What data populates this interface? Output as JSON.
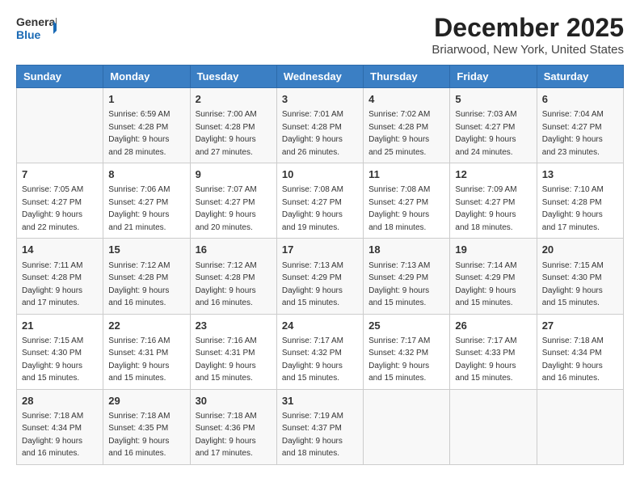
{
  "logo": {
    "line1": "General",
    "line2": "Blue"
  },
  "title": "December 2025",
  "subtitle": "Briarwood, New York, United States",
  "header_color": "#3b7fc4",
  "days_of_week": [
    "Sunday",
    "Monday",
    "Tuesday",
    "Wednesday",
    "Thursday",
    "Friday",
    "Saturday"
  ],
  "weeks": [
    [
      {
        "num": "",
        "sunrise": "",
        "sunset": "",
        "daylight": ""
      },
      {
        "num": "1",
        "sunrise": "Sunrise: 6:59 AM",
        "sunset": "Sunset: 4:28 PM",
        "daylight": "Daylight: 9 hours and 28 minutes."
      },
      {
        "num": "2",
        "sunrise": "Sunrise: 7:00 AM",
        "sunset": "Sunset: 4:28 PM",
        "daylight": "Daylight: 9 hours and 27 minutes."
      },
      {
        "num": "3",
        "sunrise": "Sunrise: 7:01 AM",
        "sunset": "Sunset: 4:28 PM",
        "daylight": "Daylight: 9 hours and 26 minutes."
      },
      {
        "num": "4",
        "sunrise": "Sunrise: 7:02 AM",
        "sunset": "Sunset: 4:28 PM",
        "daylight": "Daylight: 9 hours and 25 minutes."
      },
      {
        "num": "5",
        "sunrise": "Sunrise: 7:03 AM",
        "sunset": "Sunset: 4:27 PM",
        "daylight": "Daylight: 9 hours and 24 minutes."
      },
      {
        "num": "6",
        "sunrise": "Sunrise: 7:04 AM",
        "sunset": "Sunset: 4:27 PM",
        "daylight": "Daylight: 9 hours and 23 minutes."
      }
    ],
    [
      {
        "num": "7",
        "sunrise": "Sunrise: 7:05 AM",
        "sunset": "Sunset: 4:27 PM",
        "daylight": "Daylight: 9 hours and 22 minutes."
      },
      {
        "num": "8",
        "sunrise": "Sunrise: 7:06 AM",
        "sunset": "Sunset: 4:27 PM",
        "daylight": "Daylight: 9 hours and 21 minutes."
      },
      {
        "num": "9",
        "sunrise": "Sunrise: 7:07 AM",
        "sunset": "Sunset: 4:27 PM",
        "daylight": "Daylight: 9 hours and 20 minutes."
      },
      {
        "num": "10",
        "sunrise": "Sunrise: 7:08 AM",
        "sunset": "Sunset: 4:27 PM",
        "daylight": "Daylight: 9 hours and 19 minutes."
      },
      {
        "num": "11",
        "sunrise": "Sunrise: 7:08 AM",
        "sunset": "Sunset: 4:27 PM",
        "daylight": "Daylight: 9 hours and 18 minutes."
      },
      {
        "num": "12",
        "sunrise": "Sunrise: 7:09 AM",
        "sunset": "Sunset: 4:27 PM",
        "daylight": "Daylight: 9 hours and 18 minutes."
      },
      {
        "num": "13",
        "sunrise": "Sunrise: 7:10 AM",
        "sunset": "Sunset: 4:28 PM",
        "daylight": "Daylight: 9 hours and 17 minutes."
      }
    ],
    [
      {
        "num": "14",
        "sunrise": "Sunrise: 7:11 AM",
        "sunset": "Sunset: 4:28 PM",
        "daylight": "Daylight: 9 hours and 17 minutes."
      },
      {
        "num": "15",
        "sunrise": "Sunrise: 7:12 AM",
        "sunset": "Sunset: 4:28 PM",
        "daylight": "Daylight: 9 hours and 16 minutes."
      },
      {
        "num": "16",
        "sunrise": "Sunrise: 7:12 AM",
        "sunset": "Sunset: 4:28 PM",
        "daylight": "Daylight: 9 hours and 16 minutes."
      },
      {
        "num": "17",
        "sunrise": "Sunrise: 7:13 AM",
        "sunset": "Sunset: 4:29 PM",
        "daylight": "Daylight: 9 hours and 15 minutes."
      },
      {
        "num": "18",
        "sunrise": "Sunrise: 7:13 AM",
        "sunset": "Sunset: 4:29 PM",
        "daylight": "Daylight: 9 hours and 15 minutes."
      },
      {
        "num": "19",
        "sunrise": "Sunrise: 7:14 AM",
        "sunset": "Sunset: 4:29 PM",
        "daylight": "Daylight: 9 hours and 15 minutes."
      },
      {
        "num": "20",
        "sunrise": "Sunrise: 7:15 AM",
        "sunset": "Sunset: 4:30 PM",
        "daylight": "Daylight: 9 hours and 15 minutes."
      }
    ],
    [
      {
        "num": "21",
        "sunrise": "Sunrise: 7:15 AM",
        "sunset": "Sunset: 4:30 PM",
        "daylight": "Daylight: 9 hours and 15 minutes."
      },
      {
        "num": "22",
        "sunrise": "Sunrise: 7:16 AM",
        "sunset": "Sunset: 4:31 PM",
        "daylight": "Daylight: 9 hours and 15 minutes."
      },
      {
        "num": "23",
        "sunrise": "Sunrise: 7:16 AM",
        "sunset": "Sunset: 4:31 PM",
        "daylight": "Daylight: 9 hours and 15 minutes."
      },
      {
        "num": "24",
        "sunrise": "Sunrise: 7:17 AM",
        "sunset": "Sunset: 4:32 PM",
        "daylight": "Daylight: 9 hours and 15 minutes."
      },
      {
        "num": "25",
        "sunrise": "Sunrise: 7:17 AM",
        "sunset": "Sunset: 4:32 PM",
        "daylight": "Daylight: 9 hours and 15 minutes."
      },
      {
        "num": "26",
        "sunrise": "Sunrise: 7:17 AM",
        "sunset": "Sunset: 4:33 PM",
        "daylight": "Daylight: 9 hours and 15 minutes."
      },
      {
        "num": "27",
        "sunrise": "Sunrise: 7:18 AM",
        "sunset": "Sunset: 4:34 PM",
        "daylight": "Daylight: 9 hours and 16 minutes."
      }
    ],
    [
      {
        "num": "28",
        "sunrise": "Sunrise: 7:18 AM",
        "sunset": "Sunset: 4:34 PM",
        "daylight": "Daylight: 9 hours and 16 minutes."
      },
      {
        "num": "29",
        "sunrise": "Sunrise: 7:18 AM",
        "sunset": "Sunset: 4:35 PM",
        "daylight": "Daylight: 9 hours and 16 minutes."
      },
      {
        "num": "30",
        "sunrise": "Sunrise: 7:18 AM",
        "sunset": "Sunset: 4:36 PM",
        "daylight": "Daylight: 9 hours and 17 minutes."
      },
      {
        "num": "31",
        "sunrise": "Sunrise: 7:19 AM",
        "sunset": "Sunset: 4:37 PM",
        "daylight": "Daylight: 9 hours and 18 minutes."
      },
      {
        "num": "",
        "sunrise": "",
        "sunset": "",
        "daylight": ""
      },
      {
        "num": "",
        "sunrise": "",
        "sunset": "",
        "daylight": ""
      },
      {
        "num": "",
        "sunrise": "",
        "sunset": "",
        "daylight": ""
      }
    ]
  ]
}
